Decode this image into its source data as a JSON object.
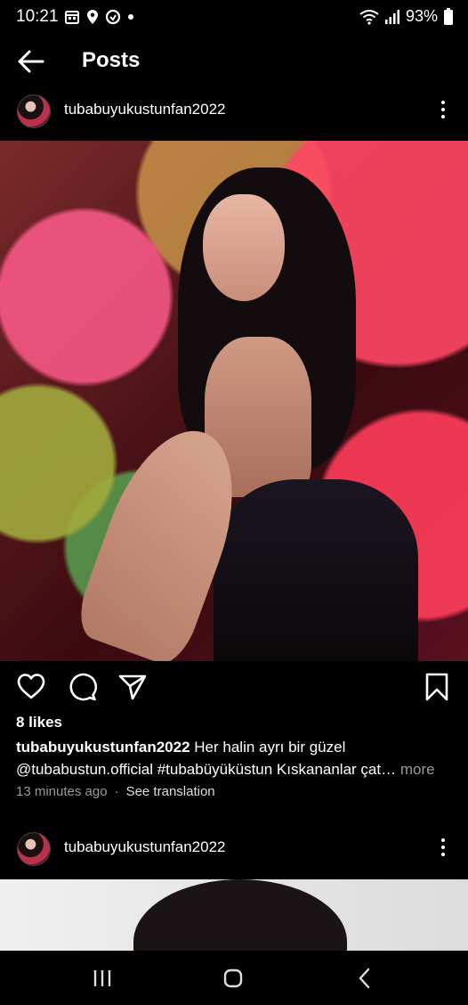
{
  "status_bar": {
    "time": "10:21",
    "battery": "93%"
  },
  "header": {
    "title": "Posts"
  },
  "post1": {
    "username": "tubabuyukustunfan2022",
    "likes": "8 likes",
    "caption_user": "tubabuyukustunfan2022",
    "caption_line1": " Her halin ayrı bir güzel",
    "caption_line2": "@tubabustun.official #tubabüyüküstun Kıskananlar çat…",
    "caption_more": "more",
    "time_ago": "13 minutes ago",
    "dot": "·",
    "see_translation": "See translation"
  },
  "post2": {
    "username": "tubabuyukustunfan2022"
  },
  "icons": {
    "back": "arrow-left-icon",
    "more": "more-vertical-icon",
    "like": "heart-icon",
    "comment": "comment-icon",
    "share": "send-icon",
    "save": "bookmark-icon"
  },
  "colors": {
    "background": "#000000",
    "secondary_text": "#9a9a9a"
  }
}
